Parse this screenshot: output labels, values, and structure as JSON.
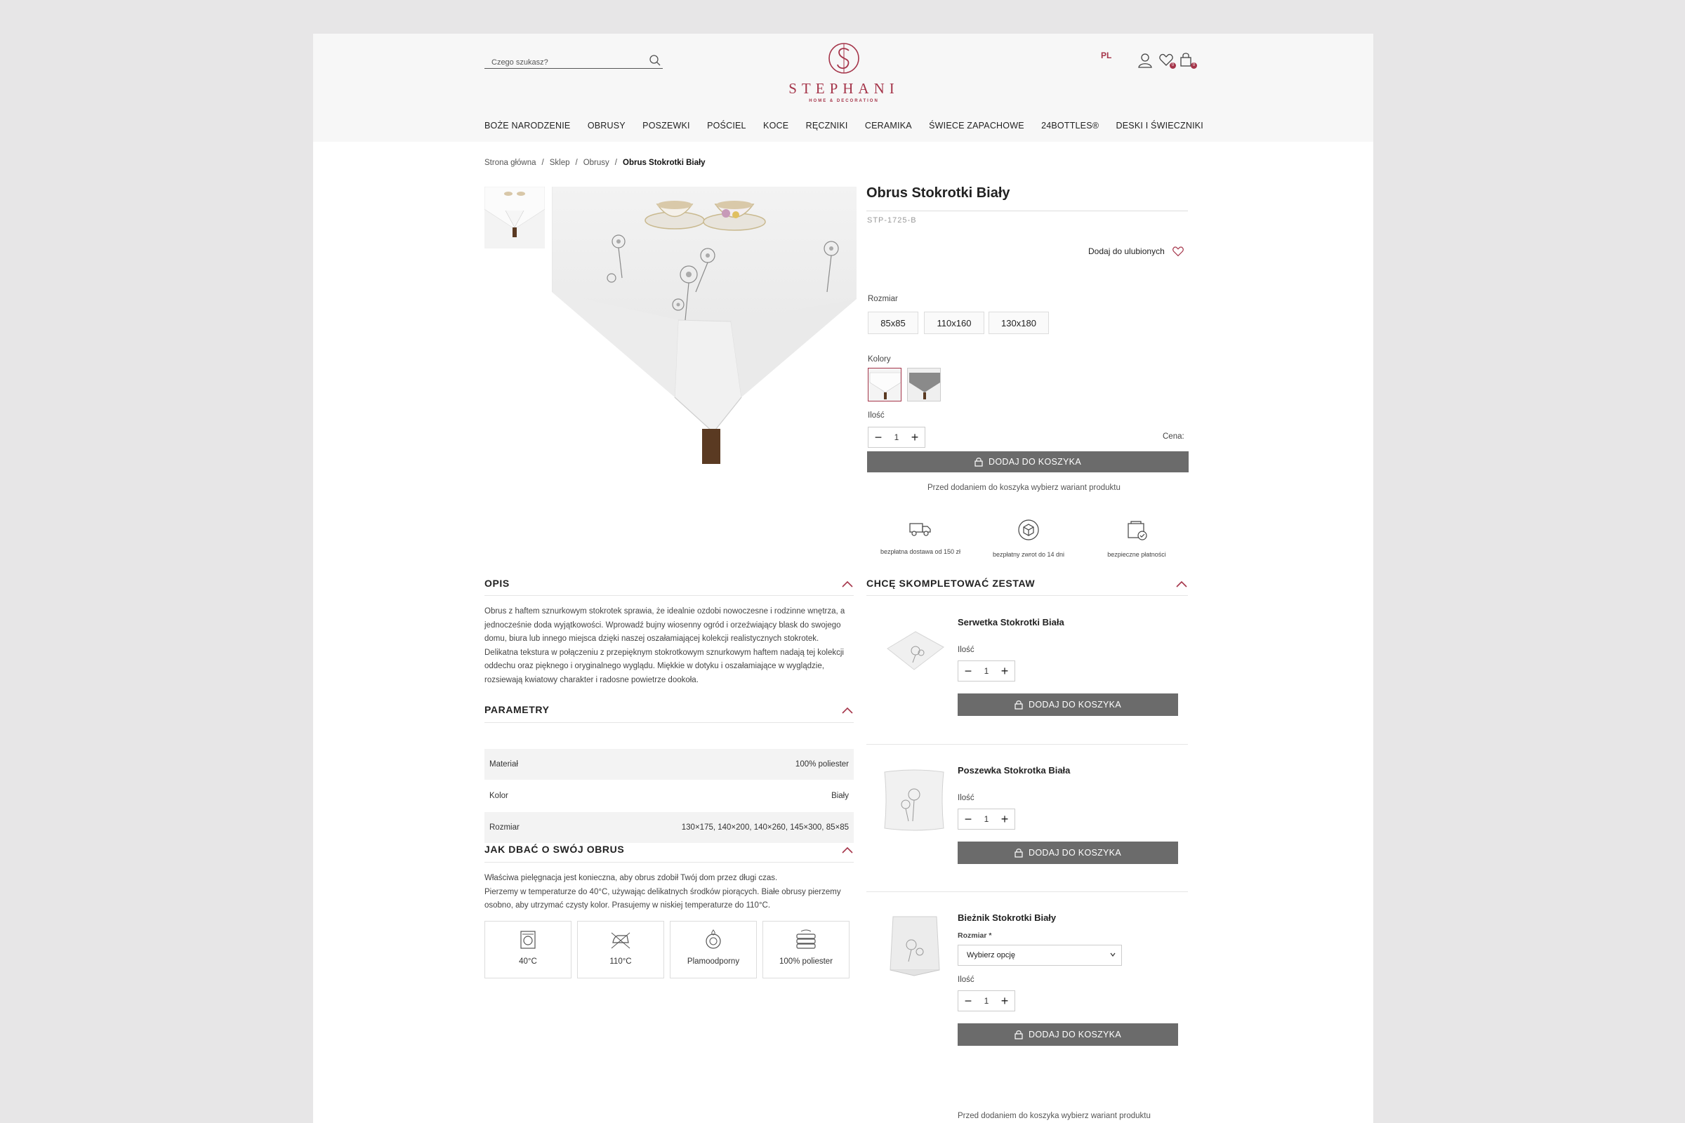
{
  "header": {
    "search_placeholder": "Czego szukasz?",
    "logo_text": "STEPHANI",
    "logo_sub": "HOME & DECORATION",
    "lang": "PL",
    "wishlist_count": "0",
    "cart_count": "0"
  },
  "nav": [
    "BOŻE NARODZENIE",
    "OBRUSY",
    "POSZEWKI",
    "POŚCIEL",
    "KOCE",
    "RĘCZNIKI",
    "CERAMIKA",
    "ŚWIECE ZAPACHOWE",
    "24BOTTLES®",
    "DESKI I ŚWIECZNIKI"
  ],
  "breadcrumb": [
    "Strona główna",
    "Sklep",
    "Obrusy",
    "Obrus Stokrotki Biały"
  ],
  "product": {
    "title": "Obrus Stokrotki Biały",
    "sku": "STP-1725-B",
    "favorite_label": "Dodaj do ulubionych",
    "size_label": "Rozmiar",
    "sizes": [
      "85x85",
      "110x160",
      "130x180"
    ],
    "colors_label": "Kolory",
    "qty_label": "Ilość",
    "qty": "1",
    "price_label": "Cena:",
    "add_to_cart": "DODAJ DO KOSZYKA",
    "variant_note": "Przed dodaniem do koszyka wybierz wariant produktu"
  },
  "perks": [
    "bezpłatna dostawa od 150 zł",
    "bezpłatny zwrot do 14 dni",
    "bezpieczne płatności"
  ],
  "description": {
    "title": "OPIS",
    "text": "Obrus z haftem sznurkowym stokrotek sprawia, że idealnie ozdobi nowoczesne i rodzinne wnętrza, a jednocześnie doda wyjątkowości. Wprowadź bujny wiosenny ogród i orzeźwiający blask do swojego domu, biura lub innego miejsca dzięki naszej oszałamiającej kolekcji realistycznych stokrotek. Delikatna tekstura w połączeniu z przepięknym stokrotkowym sznurkowym haftem nadają tej kolekcji oddechu oraz pięknego i oryginalnego wyglądu. Miękkie w dotyku i oszałamiające w wyglądzie, rozsiewają kwiatowy charakter i radosne powietrze dookoła."
  },
  "parameters": {
    "title": "PARAMETRY",
    "rows": [
      {
        "name": "Materiał",
        "value": "100% poliester"
      },
      {
        "name": "Kolor",
        "value": "Biały"
      },
      {
        "name": "Rozmiar",
        "value": "130×175, 140×200, 140×260, 145×300, 85×85"
      }
    ]
  },
  "care": {
    "title": "JAK DBAĆ O SWÓJ OBRUS",
    "line1": "Właściwa pielęgnacja jest konieczna, aby obrus zdobił Twój dom przez długi czas.",
    "line2": "Pierzemy w temperaturze do 40°C, używając delikatnych środków piorących. Białe obrusy pierzemy osobno, aby utrzymać czysty kolor. Prasujemy w niskiej temperaturze do 110°C.",
    "items": [
      "40°C",
      "110°C",
      "Plamoodporny",
      "100% poliester"
    ]
  },
  "set": {
    "title": "CHCĘ SKOMPLETOWAĆ ZESTAW",
    "qty_label": "Ilość",
    "add_to_cart": "DODAJ DO KOSZYKA",
    "products": [
      {
        "name": "Serwetka Stokrotki Biała",
        "qty": "1"
      },
      {
        "name": "Poszewka Stokrotka Biała",
        "qty": "1"
      },
      {
        "name": "Bieżnik Stokrotki Biały",
        "qty": "1",
        "size_label": "Rozmiar *",
        "select": "Wybierz opcję"
      }
    ],
    "note": "Przed dodaniem do koszyka wybierz wariant produktu"
  },
  "colors": {
    "accent": "#a5354a",
    "button": "#6b6b6b",
    "header_bg": "#f7f7f7",
    "outer_bg": "#e7e6e7"
  }
}
